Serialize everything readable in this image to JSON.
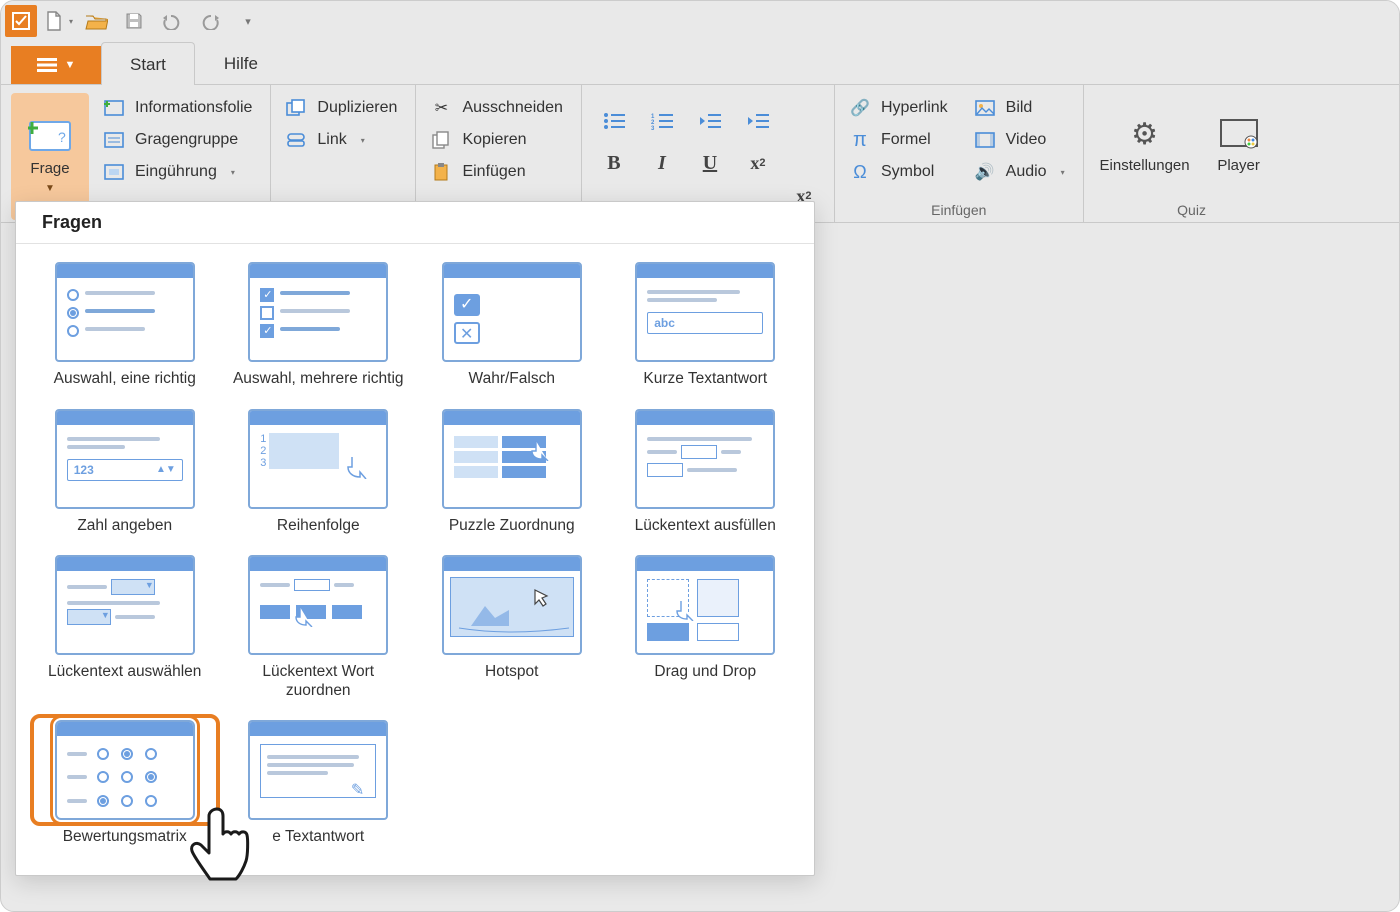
{
  "qat": {
    "icons": [
      "app",
      "new",
      "open",
      "save",
      "undo",
      "redo",
      "customize"
    ]
  },
  "tabs": {
    "file_icon": "list",
    "start": "Start",
    "help": "Hilfe",
    "active": "Start"
  },
  "ribbon": {
    "frage_btn": "Frage",
    "slide_items": [
      {
        "icon": "info-slide",
        "label": "Informationsfolie"
      },
      {
        "icon": "group",
        "label": "Gragengruppe"
      },
      {
        "icon": "intro",
        "label": "Eingührung",
        "dropdown": true
      }
    ],
    "clip1": [
      {
        "icon": "duplicate",
        "label": "Duplizieren"
      },
      {
        "icon": "link",
        "label": "Link",
        "dropdown": true
      }
    ],
    "clip2": [
      {
        "icon": "cut",
        "label": "Ausschneiden"
      },
      {
        "icon": "copy",
        "label": "Kopieren"
      },
      {
        "icon": "paste",
        "label": "Einfügen"
      }
    ],
    "insert_group_label": "Einfügen",
    "insert_items": [
      {
        "icon": "hyperlink",
        "label": "Hyperlink"
      },
      {
        "icon": "formula",
        "label": "Formel"
      },
      {
        "icon": "symbol",
        "label": "Symbol"
      }
    ],
    "media_items": [
      {
        "icon": "image",
        "label": "Bild"
      },
      {
        "icon": "video",
        "label": "Video"
      },
      {
        "icon": "audio",
        "label": "Audio",
        "dropdown": true
      }
    ],
    "quiz_group_label": "Quiz",
    "quiz_items": [
      {
        "icon": "settings",
        "label": "Einstellungen"
      },
      {
        "icon": "player",
        "label": "Player"
      }
    ]
  },
  "dropdown": {
    "title": "Fragen",
    "items": [
      {
        "id": "single-choice",
        "label": "Auswahl, eine richtig"
      },
      {
        "id": "multiple-choice",
        "label": "Auswahl, mehrere richtig"
      },
      {
        "id": "true-false",
        "label": "Wahr/Falsch"
      },
      {
        "id": "short-answer",
        "label": "Kurze Textantwort"
      },
      {
        "id": "numeric",
        "label": "Zahl angeben"
      },
      {
        "id": "sequence",
        "label": "Reihenfolge"
      },
      {
        "id": "matching",
        "label": "Puzzle Zuordnung"
      },
      {
        "id": "fill-blank",
        "label": "Lückentext ausfüllen"
      },
      {
        "id": "select-blank",
        "label": "Lückentext auswählen"
      },
      {
        "id": "word-bank",
        "label": "Lückentext  Wort zuordnen"
      },
      {
        "id": "hotspot",
        "label": "Hotspot"
      },
      {
        "id": "drag-drop",
        "label": "Drag und Drop"
      },
      {
        "id": "likert",
        "label": "Bewertungsmatrix",
        "selected": true
      },
      {
        "id": "essay",
        "label": " e Textantwort"
      }
    ]
  },
  "thumb_text": {
    "abc": "abc",
    "num": "123"
  },
  "colors": {
    "accent": "#e87e22",
    "ribbon_blue": "#4b8dd8"
  }
}
